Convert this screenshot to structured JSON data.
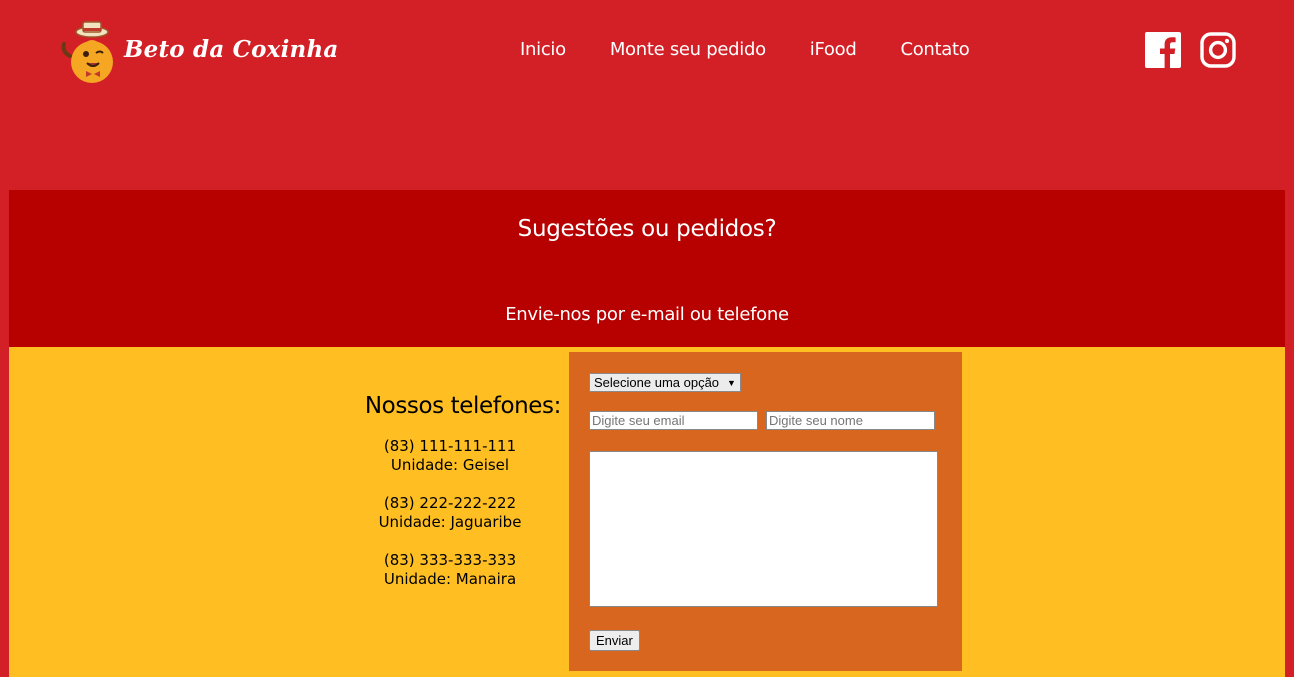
{
  "brand": {
    "name": "Beto da Coxinha",
    "logo_icon": "coxinha-mascot-icon"
  },
  "nav": [
    {
      "label": "Inicio"
    },
    {
      "label": "Monte seu pedido"
    },
    {
      "label": "iFood"
    },
    {
      "label": "Contato"
    }
  ],
  "social": [
    {
      "icon": "facebook-icon"
    },
    {
      "icon": "instagram-icon"
    }
  ],
  "banner": {
    "title": "Sugestões ou pedidos?",
    "subtitle": "Envie-nos por e-mail ou telefone"
  },
  "phones": {
    "title": "Nossos telefones:",
    "items": [
      {
        "number": "(83) 111-111-111",
        "unit": "Unidade: Geisel"
      },
      {
        "number": "(83) 222-222-222",
        "unit": "Unidade: Jaguaribe"
      },
      {
        "number": "(83) 333-333-333",
        "unit": "Unidade: Manaira"
      }
    ]
  },
  "form": {
    "select_value": "Selecione uma opção",
    "email_placeholder": "Digite seu email",
    "name_placeholder": "Digite seu nome",
    "message_value": "",
    "submit_label": "Enviar"
  },
  "colors": {
    "header_bg": "#d32027",
    "banner_bg": "#b70000",
    "content_bg": "#ffbf23",
    "form_bg": "#d8661f"
  }
}
